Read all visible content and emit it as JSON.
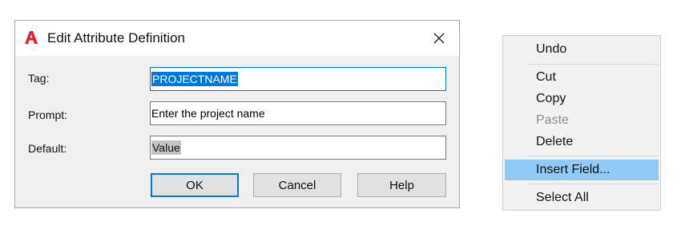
{
  "dialog": {
    "title": "Edit Attribute Definition",
    "close_symbol": "✕",
    "fields": {
      "tag": {
        "label": "Tag:",
        "value": "PROJECTNAME"
      },
      "prompt": {
        "label": "Prompt:",
        "value": "Enter the project name"
      },
      "default": {
        "label": "Default:",
        "value": "Value"
      }
    },
    "buttons": {
      "ok": "OK",
      "cancel": "Cancel",
      "help": "Help"
    },
    "icons": {
      "app": "autocad-logo-icon",
      "close": "close-icon"
    },
    "colors": {
      "accent": "#0078d7",
      "logo": "#e51e25"
    }
  },
  "context_menu": {
    "items": [
      {
        "label": "Undo",
        "enabled": true
      },
      {
        "label": "Cut",
        "enabled": true
      },
      {
        "label": "Copy",
        "enabled": true
      },
      {
        "label": "Paste",
        "enabled": false
      },
      {
        "label": "Delete",
        "enabled": true
      },
      {
        "label": "Insert Field...",
        "enabled": true,
        "highlighted": true
      },
      {
        "label": "Select All",
        "enabled": true
      }
    ]
  }
}
